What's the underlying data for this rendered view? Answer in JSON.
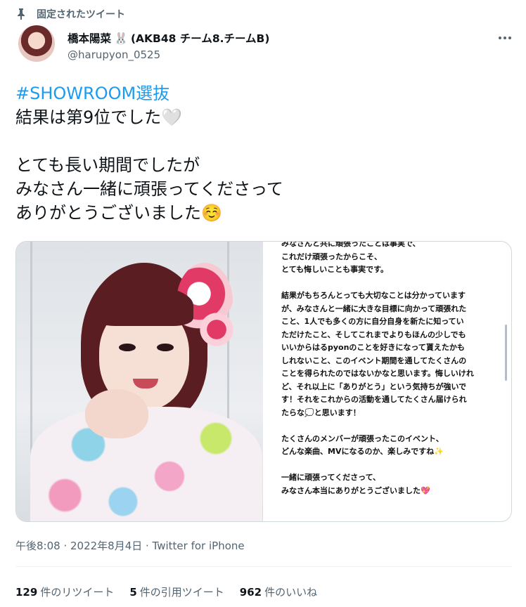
{
  "pinned": {
    "label": "固定されたツイート",
    "icon": "pin-icon"
  },
  "author": {
    "name_main": "橋本陽菜",
    "name_emoji": "🐰",
    "name_suffix": "(AKB48 チーム8.チームB)",
    "handle": "@harupyon_0525",
    "more_icon": "more-icon"
  },
  "tweet": {
    "hashtag": "#SHOWROOM選抜",
    "line1": "結果は第9位でした🤍",
    "line2": "とても長い期間でしたが",
    "line3": "みなさん一緒に頑張ってくださって",
    "line4": "ありがとうございました☺️"
  },
  "media": {
    "notes_text": "みなさんと共に頑張ったことは事実で、\nこれだけ頑張ったからこそ、\nとても悔しいことも事実です。\n\n結果がもちろんとっても大切なことは分かっています\nが、みなさんと一緒に大きな目標に向かって頑張れた\nこと、1人でも多くの方に自分自身を新たに知ってい\nただけたこと、そしてこれまでよりもほんの少しでも\nいいからはるpyonのことを好きになって貰えたかも\nしれないこと、このイベント期間を通してたくさんの\nことを得られたのではないかなと思います。悔しいけれ\nど、それ以上に「ありがとう」という気持ちが強いで\nす！それをこれからの活動を通してたくさん届けられ\nたらな💭と思います！\n\nたくさんのメンバーが頑張ったこのイベント、\nどんな楽曲、MVになるのか、楽しみですね✨\n\n一緒に頑張ってくださって、\nみなさん本当にありがとうございました💖"
  },
  "meta": {
    "text": "午後8:08 · 2022年8月4日 · Twitter for iPhone"
  },
  "stats": {
    "retweets_count": "129",
    "retweets_label": "件のリツイート",
    "quotes_count": "5",
    "quotes_label": "件の引用ツイート",
    "likes_count": "962",
    "likes_label": "件のいいね"
  },
  "colors": {
    "hashtag": "#1d9bf0",
    "secondary_text": "#536471",
    "primary_text": "#0f1419",
    "border": "#cfd9de"
  }
}
